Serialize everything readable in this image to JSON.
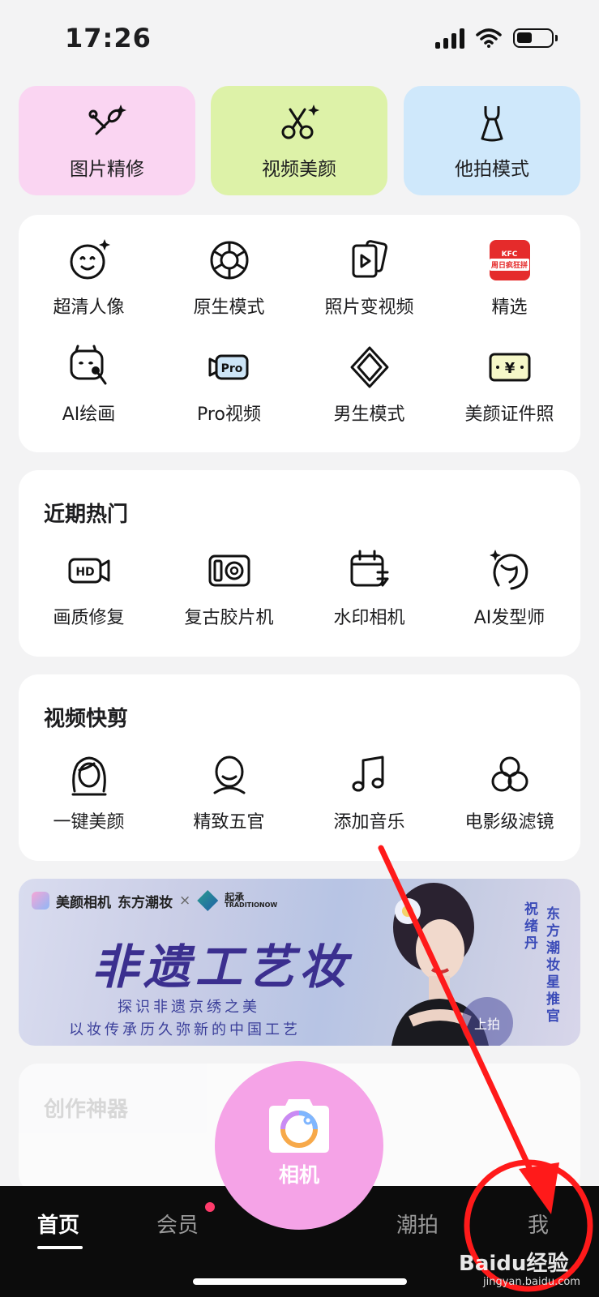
{
  "status_bar": {
    "time": "17:26"
  },
  "mode_cards": [
    {
      "label": "图片精修",
      "bg": "#fad5f2",
      "icon": "makeup-brush-icon"
    },
    {
      "label": "视频美颜",
      "bg": "#ddf2a8",
      "icon": "scissors-icon"
    },
    {
      "label": "他拍模式",
      "bg": "#cfe8fb",
      "icon": "dress-icon"
    }
  ],
  "tools": {
    "row1": [
      {
        "label": "超清人像",
        "icon": "face-sparkle-icon"
      },
      {
        "label": "原生模式",
        "icon": "aperture-icon"
      },
      {
        "label": "照片变视频",
        "icon": "photo-video-icon"
      },
      {
        "label": "精选",
        "icon": "promo-thumbnail-icon"
      }
    ],
    "row2": [
      {
        "label": "AI绘画",
        "icon": "ai-paint-icon"
      },
      {
        "label": "Pro视频",
        "icon": "pro-video-icon"
      },
      {
        "label": "男生模式",
        "icon": "diamond-icon"
      },
      {
        "label": "美颜证件照",
        "icon": "id-photo-icon"
      }
    ],
    "promo_text": "周日疯狂拼"
  },
  "recent_hot": {
    "title": "近期热门",
    "items": [
      {
        "label": "画质修复",
        "icon": "hd-video-icon"
      },
      {
        "label": "复古胶片机",
        "icon": "film-camera-icon"
      },
      {
        "label": "水印相机",
        "icon": "calendar-edit-icon"
      },
      {
        "label": "AI发型师",
        "icon": "hairstyle-icon"
      }
    ]
  },
  "video_edit": {
    "title": "视频快剪",
    "items": [
      {
        "label": "一键美颜",
        "icon": "woman-face-icon"
      },
      {
        "label": "精致五官",
        "icon": "face-outline-icon"
      },
      {
        "label": "添加音乐",
        "icon": "music-note-icon"
      },
      {
        "label": "电影级滤镜",
        "icon": "filter-circles-icon"
      }
    ]
  },
  "banner": {
    "brand_1": "美颜相机",
    "brand_2": "东方潮妆",
    "cross": "×",
    "partner": "起承",
    "partner_en": "TRADITIONOW",
    "headline": "非遗工艺妆",
    "sub1": "探识非遗京绣之美",
    "sub2": "以妆传承历久弥新的中国工艺",
    "vertical_1": "东方潮妆星推官",
    "vertical_2": "祝绪丹",
    "shoot": "上拍"
  },
  "creation": {
    "title": "创作神器"
  },
  "camera": {
    "label": "相机"
  },
  "tab_bar": {
    "home": "首页",
    "vip": "会员",
    "trend": "潮拍",
    "me": "我"
  },
  "watermark": {
    "brand": "Baidu经验",
    "url": "jingyan.baidu.com"
  },
  "colors": {
    "accent": "#f5a3e7",
    "annotation": "#ff1a1a",
    "tabbar": "#0c0c0c"
  }
}
